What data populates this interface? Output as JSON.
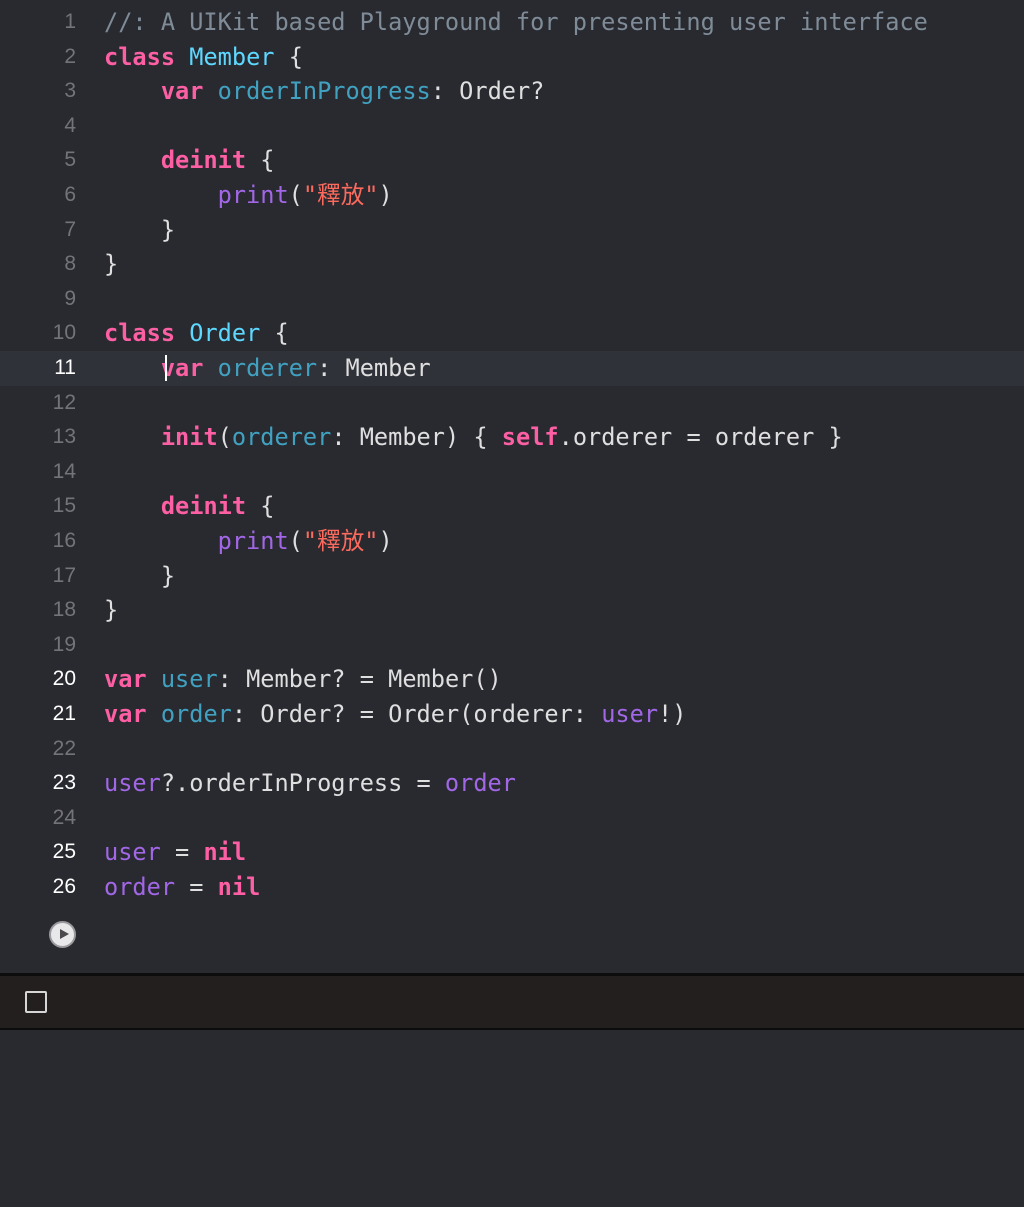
{
  "editor": {
    "current_line": 11,
    "lines": [
      {
        "n": "1",
        "tokens": [
          {
            "t": "comment",
            "v": "//: A UIKit based Playground for presenting user interface"
          }
        ]
      },
      {
        "n": "2",
        "tokens": [
          {
            "t": "kw",
            "v": "class"
          },
          {
            "t": "plain",
            "v": " "
          },
          {
            "t": "typedecl",
            "v": "Member"
          },
          {
            "t": "plain",
            "v": " {"
          }
        ]
      },
      {
        "n": "3",
        "tokens": [
          {
            "t": "plain",
            "v": "    "
          },
          {
            "t": "kw",
            "v": "var"
          },
          {
            "t": "plain",
            "v": " "
          },
          {
            "t": "var",
            "v": "orderInProgress"
          },
          {
            "t": "plain",
            "v": ": Order?"
          }
        ]
      },
      {
        "n": "4",
        "tokens": []
      },
      {
        "n": "5",
        "tokens": [
          {
            "t": "plain",
            "v": "    "
          },
          {
            "t": "kw",
            "v": "deinit"
          },
          {
            "t": "plain",
            "v": " {"
          }
        ]
      },
      {
        "n": "6",
        "tokens": [
          {
            "t": "plain",
            "v": "        "
          },
          {
            "t": "fn",
            "v": "print"
          },
          {
            "t": "plain",
            "v": "("
          },
          {
            "t": "str",
            "v": "\"釋放\""
          },
          {
            "t": "plain",
            "v": ")"
          }
        ]
      },
      {
        "n": "7",
        "tokens": [
          {
            "t": "plain",
            "v": "    }"
          }
        ]
      },
      {
        "n": "8",
        "tokens": [
          {
            "t": "plain",
            "v": "}"
          }
        ]
      },
      {
        "n": "9",
        "tokens": []
      },
      {
        "n": "10",
        "tokens": [
          {
            "t": "kw",
            "v": "class"
          },
          {
            "t": "plain",
            "v": " "
          },
          {
            "t": "typedecl",
            "v": "Order"
          },
          {
            "t": "plain",
            "v": " {"
          }
        ]
      },
      {
        "n": "11",
        "tokens": [
          {
            "t": "plain",
            "v": "    "
          },
          {
            "t": "kw",
            "v": "var"
          },
          {
            "t": "plain",
            "v": " "
          },
          {
            "t": "var",
            "v": "orderer"
          },
          {
            "t": "plain",
            "v": ": Member"
          }
        ]
      },
      {
        "n": "12",
        "tokens": []
      },
      {
        "n": "13",
        "tokens": [
          {
            "t": "plain",
            "v": "    "
          },
          {
            "t": "kw",
            "v": "init"
          },
          {
            "t": "plain",
            "v": "("
          },
          {
            "t": "var",
            "v": "orderer"
          },
          {
            "t": "plain",
            "v": ": Member) { "
          },
          {
            "t": "kw",
            "v": "self"
          },
          {
            "t": "plain",
            "v": ".orderer = orderer }"
          }
        ]
      },
      {
        "n": "14",
        "tokens": []
      },
      {
        "n": "15",
        "tokens": [
          {
            "t": "plain",
            "v": "    "
          },
          {
            "t": "kw",
            "v": "deinit"
          },
          {
            "t": "plain",
            "v": " {"
          }
        ]
      },
      {
        "n": "16",
        "tokens": [
          {
            "t": "plain",
            "v": "        "
          },
          {
            "t": "fn",
            "v": "print"
          },
          {
            "t": "plain",
            "v": "("
          },
          {
            "t": "str",
            "v": "\"釋放\""
          },
          {
            "t": "plain",
            "v": ")"
          }
        ]
      },
      {
        "n": "17",
        "tokens": [
          {
            "t": "plain",
            "v": "    }"
          }
        ]
      },
      {
        "n": "18",
        "tokens": [
          {
            "t": "plain",
            "v": "}"
          }
        ]
      },
      {
        "n": "19",
        "tokens": []
      },
      {
        "n": "20",
        "tokens": [
          {
            "t": "kw",
            "v": "var"
          },
          {
            "t": "plain",
            "v": " "
          },
          {
            "t": "var",
            "v": "user"
          },
          {
            "t": "plain",
            "v": ": Member? = Member()"
          }
        ]
      },
      {
        "n": "21",
        "tokens": [
          {
            "t": "kw",
            "v": "var"
          },
          {
            "t": "plain",
            "v": " "
          },
          {
            "t": "var",
            "v": "order"
          },
          {
            "t": "plain",
            "v": ": Order? = Order(orderer: "
          },
          {
            "t": "fn",
            "v": "user"
          },
          {
            "t": "plain",
            "v": "!)"
          }
        ]
      },
      {
        "n": "22",
        "tokens": []
      },
      {
        "n": "23",
        "tokens": [
          {
            "t": "fn",
            "v": "user"
          },
          {
            "t": "plain",
            "v": "?.orderInProgress = "
          },
          {
            "t": "fn",
            "v": "order"
          }
        ]
      },
      {
        "n": "24",
        "tokens": []
      },
      {
        "n": "25",
        "tokens": [
          {
            "t": "fn",
            "v": "user"
          },
          {
            "t": "plain",
            "v": " = "
          },
          {
            "t": "kw",
            "v": "nil"
          }
        ]
      },
      {
        "n": "26",
        "tokens": [
          {
            "t": "fn",
            "v": "order"
          },
          {
            "t": "plain",
            "v": " = "
          },
          {
            "t": "kw",
            "v": "nil"
          }
        ]
      }
    ],
    "active_line_numbers": [
      "11",
      "20",
      "21",
      "23",
      "25",
      "26"
    ],
    "run_button_icon": "play-circle-icon"
  },
  "debug_area": {
    "toggle_icon": "checkbox-square-icon"
  },
  "console": {
    "output": ""
  },
  "colors": {
    "background": "#292a30",
    "keyword": "#fc5fa3",
    "type_declaration": "#5dd8ff",
    "variable": "#41a1c0",
    "function_or_identifier": "#a167e6",
    "string": "#fc6a5d",
    "comment": "#7f8c98",
    "plain": "#dfdfe0",
    "line_number": "#747478",
    "current_line_highlight": "#2f3239",
    "debug_bar": "#231f1f"
  }
}
